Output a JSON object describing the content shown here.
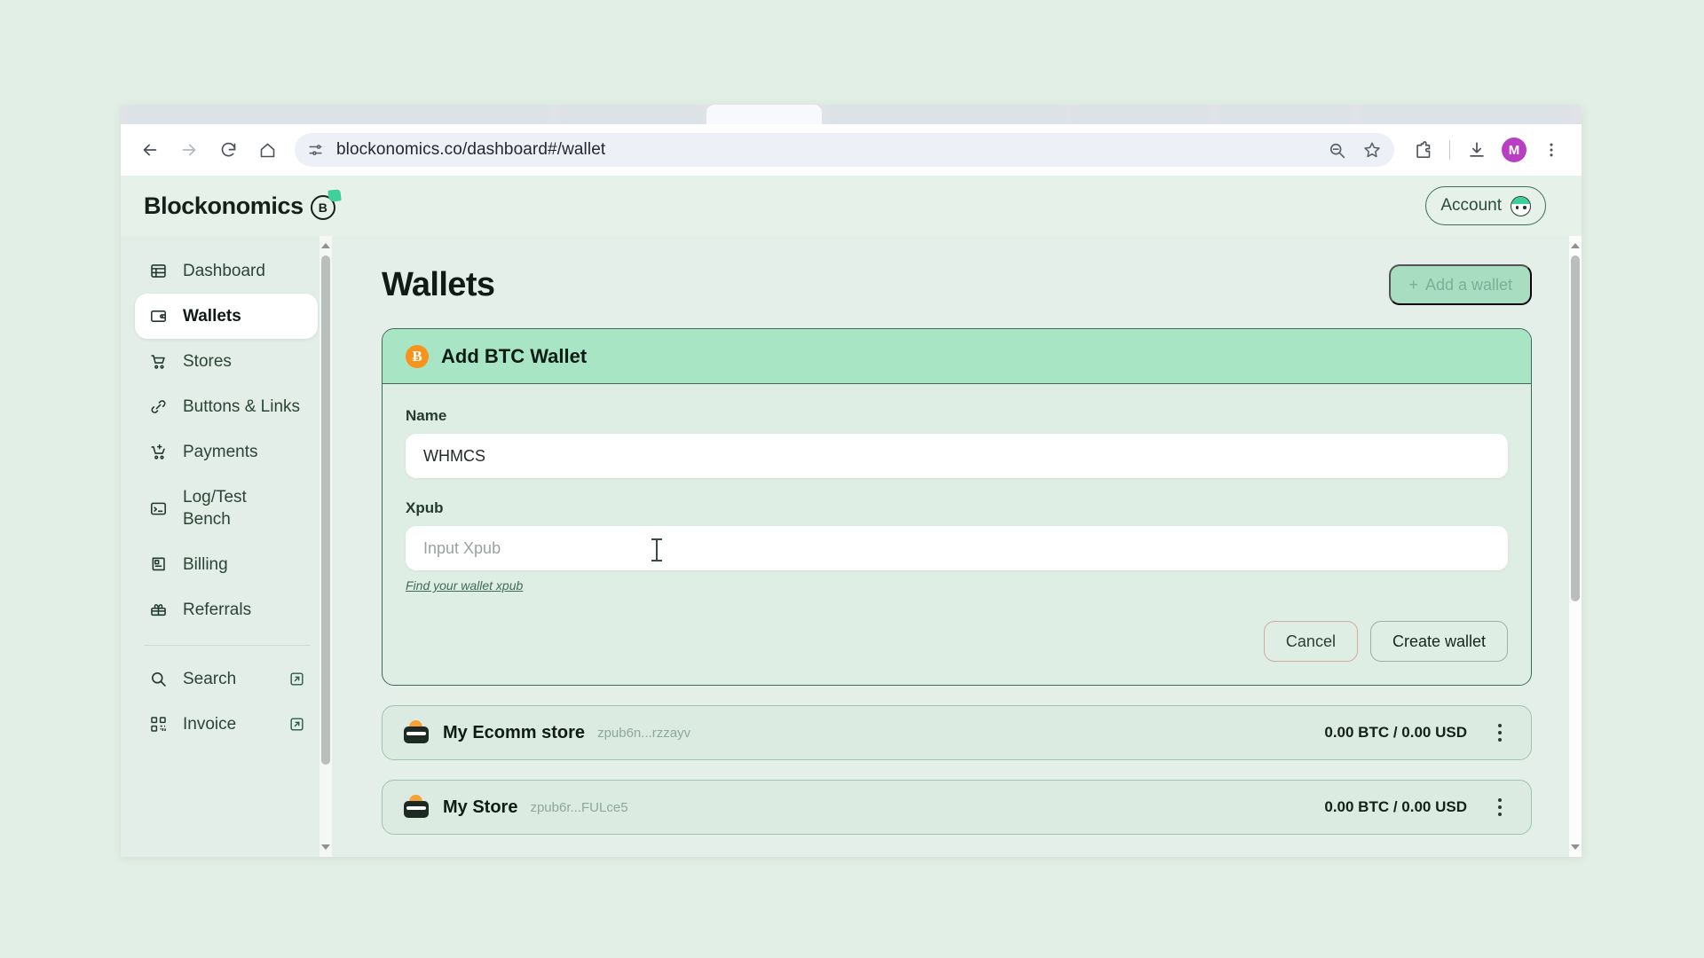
{
  "browser": {
    "url": "blockonomics.co/dashboard#/wallet",
    "back_icon": "back-arrow-icon",
    "forward_icon": "forward-arrow-icon",
    "reload_icon": "reload-icon",
    "home_icon": "home-icon",
    "site_settings_icon": "site-settings-icon",
    "zoom_icon": "zoom-magnifier-icon",
    "bookmark_icon": "bookmark-star-icon",
    "extensions_icon": "extensions-puzzle-icon",
    "downloads_icon": "downloads-icon",
    "profile_initial": "M",
    "menu_icon": "three-dot-menu-icon"
  },
  "app": {
    "brand": "Blockonomics",
    "brand_mark_letter": "B",
    "account_label": "Account"
  },
  "sidebar": {
    "items": [
      {
        "label": "Dashboard",
        "icon": "dashboard-table-icon",
        "active": false,
        "external": false
      },
      {
        "label": "Wallets",
        "icon": "wallet-icon",
        "active": true,
        "external": false
      },
      {
        "label": "Stores",
        "icon": "store-cart-icon",
        "active": false,
        "external": false
      },
      {
        "label": "Buttons & Links",
        "icon": "link-chain-icon",
        "active": false,
        "external": false
      },
      {
        "label": "Payments",
        "icon": "payments-cart-icon",
        "active": false,
        "external": false
      },
      {
        "label": "Log/Test\nBench",
        "icon": "terminal-icon",
        "active": false,
        "external": false
      },
      {
        "label": "Billing",
        "icon": "billing-icon",
        "active": false,
        "external": false
      },
      {
        "label": "Referrals",
        "icon": "gift-icon",
        "active": false,
        "external": false
      }
    ],
    "footer_items": [
      {
        "label": "Search",
        "icon": "search-icon",
        "external": true
      },
      {
        "label": "Invoice",
        "icon": "qr-code-icon",
        "external": true
      }
    ]
  },
  "main": {
    "title": "Wallets",
    "add_wallet_label": "Add a wallet",
    "add_wallet_plus": "+",
    "add_wallet_disabled": true,
    "card": {
      "title": "Add BTC Wallet",
      "coin_symbol": "Ƀ",
      "fields": [
        {
          "label": "Name",
          "value": "WHMCS",
          "placeholder": ""
        },
        {
          "label": "Xpub",
          "value": "",
          "placeholder": "Input Xpub"
        }
      ],
      "help_link": "Find your wallet xpub",
      "cancel_label": "Cancel",
      "create_label": "Create wallet"
    },
    "wallets": [
      {
        "name": "My Ecomm store",
        "xpub": "zpub6n...rzzayv",
        "balance": "0.00 BTC / 0.00 USD"
      },
      {
        "name": "My Store",
        "xpub": "zpub6r...FULce5",
        "balance": "0.00 BTC / 0.00 USD"
      }
    ]
  },
  "colors": {
    "page_bg": "#e2efe6",
    "content_bg": "#e3efe8",
    "card_header": "#a8e5c5",
    "accent_green": "#3fcf9a",
    "border_green": "#3e6a55",
    "btc_orange": "#f7931a",
    "cancel_border": "#d3a9a3",
    "profile_purple": "#b83ec4"
  }
}
